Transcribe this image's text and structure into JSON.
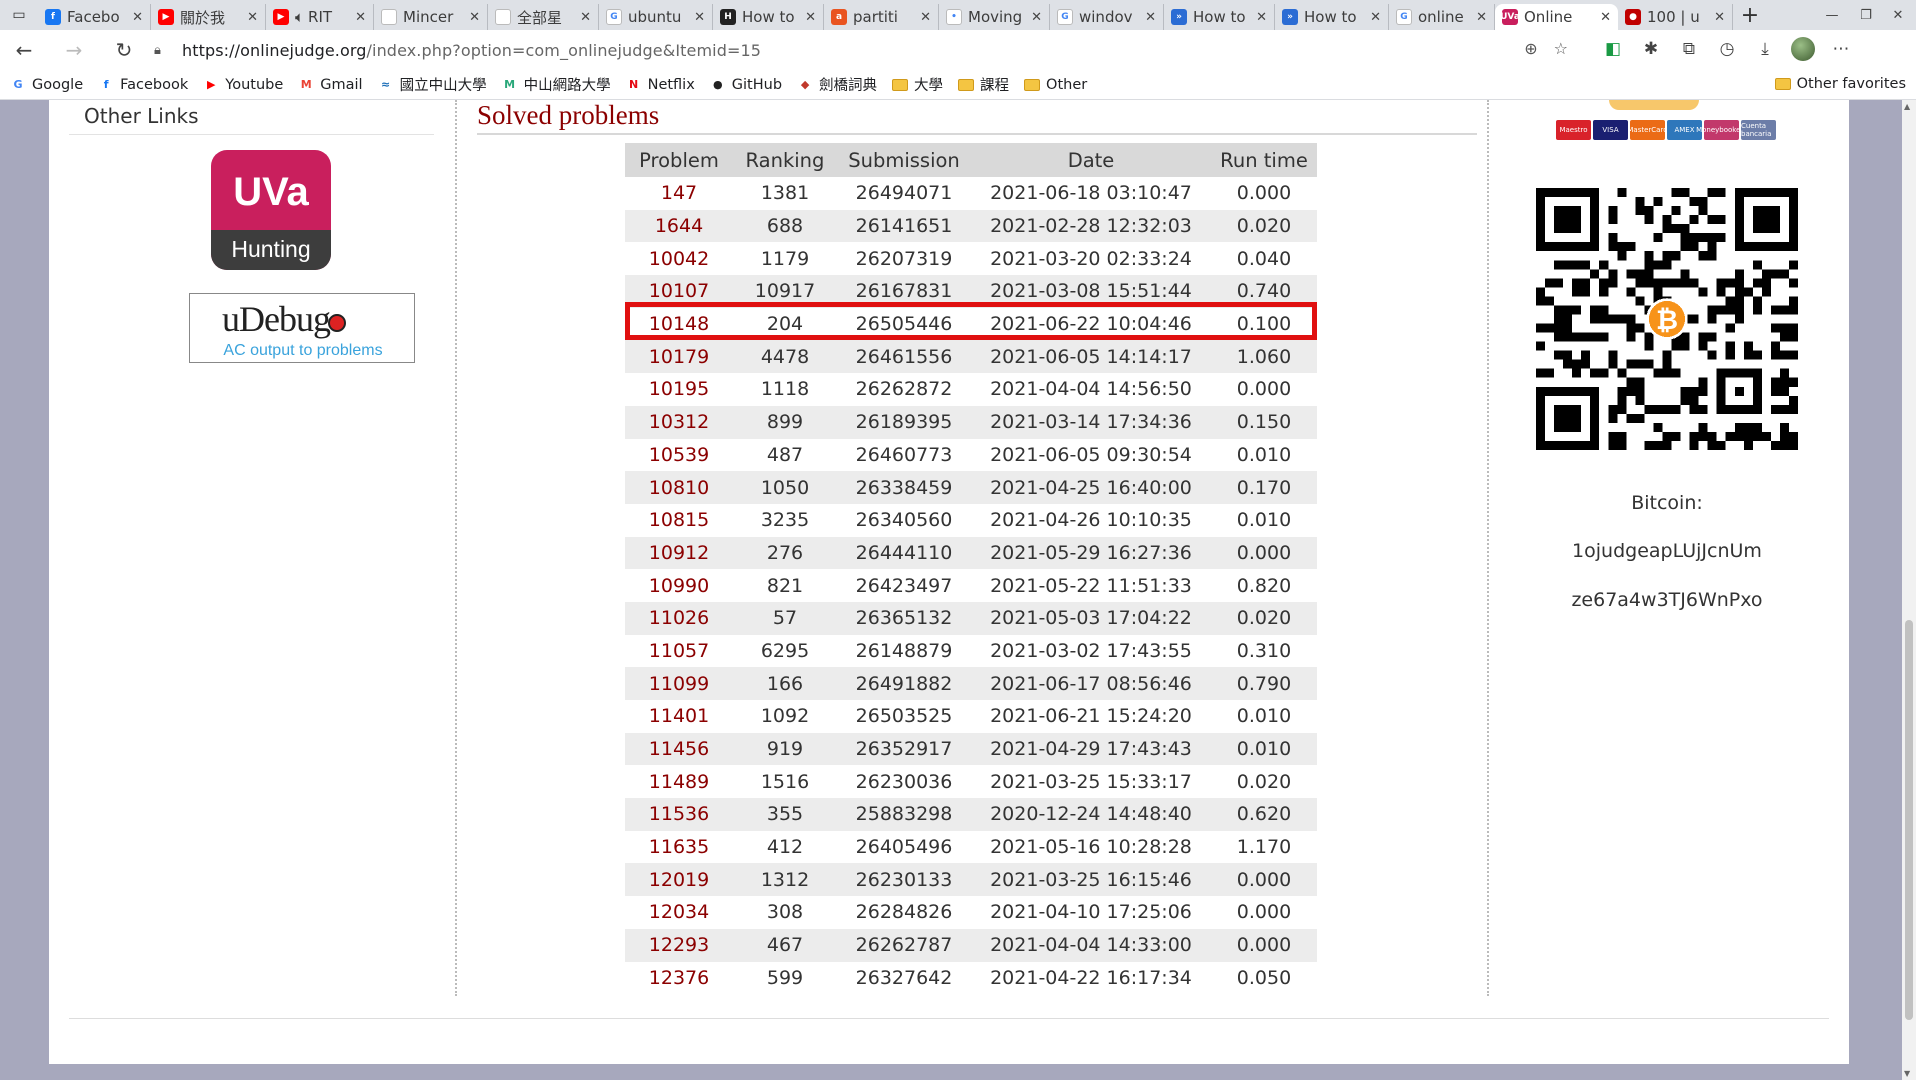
{
  "browser": {
    "tabs": [
      {
        "title": "Facebo",
        "icon": "facebook-icon",
        "color": "#1877f2",
        "glyph": "f",
        "active": false
      },
      {
        "title": "關於我",
        "icon": "youtube-icon",
        "color": "#ff0000",
        "glyph": "▶",
        "active": false
      },
      {
        "title": "RIT",
        "icon": "youtube-icon",
        "color": "#ff0000",
        "glyph": "▶",
        "active": false,
        "audio": true
      },
      {
        "title": "Mincer",
        "icon": "document-icon",
        "color": "#ffffff",
        "glyph": "",
        "active": false
      },
      {
        "title": "全部星",
        "icon": "document-icon",
        "color": "#ffffff",
        "glyph": "",
        "active": false
      },
      {
        "title": "ubuntu",
        "icon": "google-icon",
        "color": "#ffffff",
        "glyph": "G",
        "active": false
      },
      {
        "title": "How to",
        "icon": "site-icon",
        "color": "#222222",
        "glyph": "H",
        "active": false
      },
      {
        "title": "partiti",
        "icon": "askubuntu-icon",
        "color": "#e95420",
        "glyph": "a",
        "active": false
      },
      {
        "title": "Moving",
        "icon": "site-icon",
        "color": "#ffffff",
        "glyph": "•",
        "active": false
      },
      {
        "title": "windov",
        "icon": "google-icon",
        "color": "#ffffff",
        "glyph": "G",
        "active": false
      },
      {
        "title": "How to",
        "icon": "edge-icon",
        "color": "#2b6cd4",
        "glyph": "»",
        "active": false
      },
      {
        "title": "How to",
        "icon": "edge-icon",
        "color": "#2b6cd4",
        "glyph": "»",
        "active": false
      },
      {
        "title": "online",
        "icon": "google-icon",
        "color": "#ffffff",
        "glyph": "G",
        "active": false
      },
      {
        "title": "Online",
        "icon": "uva-icon",
        "color": "#c91f5d",
        "glyph": "UVa",
        "active": true
      },
      {
        "title": "100 | u",
        "icon": "udebug-icon",
        "color": "#c00000",
        "glyph": "●",
        "active": false
      }
    ],
    "url_host": "https://onlinejudge.org",
    "url_path": "/index.php?option=com_onlinejudge&Itemid=15",
    "bookmarks": [
      {
        "label": "Google",
        "icon": "google-icon",
        "glyph": "G",
        "color": "#4285f4"
      },
      {
        "label": "Facebook",
        "icon": "facebook-icon",
        "glyph": "f",
        "color": "#1877f2"
      },
      {
        "label": "Youtube",
        "icon": "youtube-icon",
        "glyph": "▶",
        "color": "#ff0000"
      },
      {
        "label": "Gmail",
        "icon": "gmail-icon",
        "glyph": "M",
        "color": "#ea4335"
      },
      {
        "label": "國立中山大學",
        "icon": "nsysu-icon",
        "glyph": "≈",
        "color": "#1d6fb8"
      },
      {
        "label": "中山網路大學",
        "icon": "cyber-univ-icon",
        "glyph": "M",
        "color": "#2aa87a"
      },
      {
        "label": "Netflix",
        "icon": "netflix-icon",
        "glyph": "N",
        "color": "#e50914"
      },
      {
        "label": "GitHub",
        "icon": "github-icon",
        "glyph": "●",
        "color": "#222222"
      },
      {
        "label": "劍橋詞典",
        "icon": "cambridge-icon",
        "glyph": "◆",
        "color": "#c0392b"
      },
      {
        "label": "大學",
        "icon": "folder-icon",
        "glyph": "",
        "color": "#f4c542"
      },
      {
        "label": "課程",
        "icon": "folder-icon",
        "glyph": "",
        "color": "#f4c542"
      },
      {
        "label": "Other",
        "icon": "folder-icon",
        "glyph": "",
        "color": "#f4c542"
      }
    ],
    "other_favorites": "Other favorites"
  },
  "sidebar": {
    "heading": "Other Links",
    "uva_logo_text": "UVa",
    "uva_logo_sub": "Hunting",
    "udebug_title": "uDebug",
    "udebug_sub": "AC output to problems"
  },
  "main": {
    "title": "Solved problems",
    "columns": [
      "Problem",
      "Ranking",
      "Submission",
      "Date",
      "Run time"
    ],
    "highlighted_problem": "10148",
    "rows": [
      [
        "147",
        "1381",
        "26494071",
        "2021-06-18 03:10:47",
        "0.000"
      ],
      [
        "1644",
        "688",
        "26141651",
        "2021-02-28 12:32:03",
        "0.020"
      ],
      [
        "10042",
        "1179",
        "26207319",
        "2021-03-20 02:33:24",
        "0.040"
      ],
      [
        "10107",
        "10917",
        "26167831",
        "2021-03-08 15:51:44",
        "0.740"
      ],
      [
        "10148",
        "204",
        "26505446",
        "2021-06-22 10:04:46",
        "0.100"
      ],
      [
        "10179",
        "4478",
        "26461556",
        "2021-06-05 14:14:17",
        "1.060"
      ],
      [
        "10195",
        "1118",
        "26262872",
        "2021-04-04 14:56:50",
        "0.000"
      ],
      [
        "10312",
        "899",
        "26189395",
        "2021-03-14 17:34:36",
        "0.150"
      ],
      [
        "10539",
        "487",
        "26460773",
        "2021-06-05 09:30:54",
        "0.010"
      ],
      [
        "10810",
        "1050",
        "26338459",
        "2021-04-25 16:40:00",
        "0.170"
      ],
      [
        "10815",
        "3235",
        "26340560",
        "2021-04-26 10:10:35",
        "0.010"
      ],
      [
        "10912",
        "276",
        "26444110",
        "2021-05-29 16:27:36",
        "0.000"
      ],
      [
        "10990",
        "821",
        "26423497",
        "2021-05-22 11:51:33",
        "0.820"
      ],
      [
        "11026",
        "57",
        "26365132",
        "2021-05-03 17:04:22",
        "0.020"
      ],
      [
        "11057",
        "6295",
        "26148879",
        "2021-03-02 17:43:55",
        "0.310"
      ],
      [
        "11099",
        "166",
        "26491882",
        "2021-06-17 08:56:46",
        "0.790"
      ],
      [
        "11401",
        "1092",
        "26503525",
        "2021-06-21 15:24:20",
        "0.010"
      ],
      [
        "11456",
        "919",
        "26352917",
        "2021-04-29 17:43:43",
        "0.010"
      ],
      [
        "11489",
        "1516",
        "26230036",
        "2021-03-25 15:33:17",
        "0.020"
      ],
      [
        "11536",
        "355",
        "25883298",
        "2020-12-24 14:48:40",
        "0.620"
      ],
      [
        "11635",
        "412",
        "26405496",
        "2021-05-16 10:28:28",
        "1.170"
      ],
      [
        "12019",
        "1312",
        "26230133",
        "2021-03-25 16:15:46",
        "0.000"
      ],
      [
        "12034",
        "308",
        "26284826",
        "2021-04-10 17:25:06",
        "0.000"
      ],
      [
        "12293",
        "467",
        "26262787",
        "2021-04-04 14:33:00",
        "0.000"
      ],
      [
        "12376",
        "599",
        "26327642",
        "2021-04-22 16:17:34",
        "0.050"
      ]
    ]
  },
  "donate": {
    "cards": [
      {
        "label": "Maestro",
        "color": "#d9222a"
      },
      {
        "label": "VISA",
        "color": "#1a1f71"
      },
      {
        "label": "MasterCard",
        "color": "#eb6b16"
      },
      {
        "label": "AMEX",
        "color": "#2e77bb"
      },
      {
        "label": "Moneybookers",
        "color": "#c2386b"
      },
      {
        "label": "Cuenta bancaria",
        "color": "#6c7da8"
      }
    ],
    "bitcoin_label": "Bitcoin:",
    "bitcoin_addr_1": "1ojudgeapLUjJcnUm",
    "bitcoin_addr_2": "ze67a4w3TJ6WnPxo",
    "bitcoin_color": "#f7931a"
  }
}
